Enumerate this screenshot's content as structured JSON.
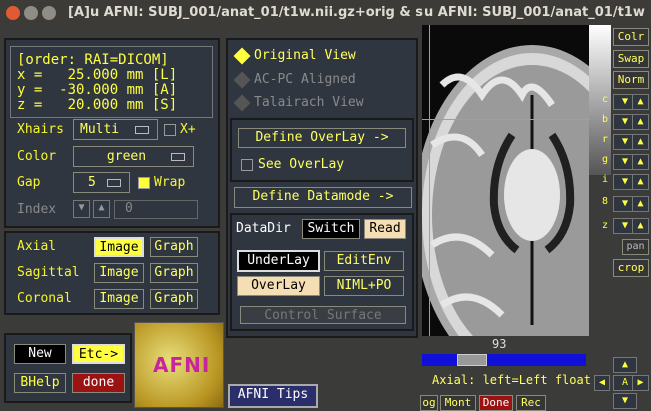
{
  "window": {
    "title": "[A]u AFNI: SUBJ_001/anat_01/t1w.nii.gz+orig & s",
    "title2": "u AFNI: SUBJ_001/anat_01/t1w"
  },
  "coords": {
    "order": "[order: RAI=DICOM]",
    "x": "x =   25.000 mm [L]",
    "y": "y =  -30.000 mm [A]",
    "z": "z =   20.000 mm [S]"
  },
  "xhairs": {
    "label": "Xhairs",
    "value": "Multi",
    "xplus": "X+"
  },
  "color": {
    "label": "Color",
    "value": "green"
  },
  "gap": {
    "label": "Gap",
    "value": "5",
    "wrap": "Wrap"
  },
  "index": {
    "label": "Index",
    "value": "0"
  },
  "views": [
    {
      "label": "Axial",
      "image": "Image",
      "graph": "Graph"
    },
    {
      "label": "Sagittal",
      "image": "Image",
      "graph": "Graph"
    },
    {
      "label": "Coronal",
      "image": "Image",
      "graph": "Graph"
    }
  ],
  "bottom": {
    "new": "New",
    "etc": "Etc->",
    "bhelp": "BHelp",
    "done": "done",
    "logo": "AFNI",
    "tips": "AFNI Tips"
  },
  "viewmode": {
    "original": "Original View",
    "acpc": "AC-PC Aligned",
    "talairach": "Talairach View"
  },
  "overlay": {
    "define": "Define OverLay ->",
    "see": "See OverLay",
    "datamode": "Define Datamode ->"
  },
  "data": {
    "datadir": "DataDir",
    "switch": "Switch",
    "read": "Read",
    "underlay": "UnderLay",
    "editenv": "EditEnv",
    "overlay": "OverLay",
    "niml": "NIML+PO",
    "control": "Control Surface"
  },
  "image": {
    "slice_num": "93",
    "status": "Axial: left=Left float",
    "buttons": [
      "Colr",
      "Swap",
      "Norm",
      "pan",
      "crop"
    ],
    "side": [
      "c",
      "b",
      "r",
      "g",
      "i",
      "8",
      "z"
    ],
    "bottom_btns": [
      "og",
      "Mont",
      "Done",
      "Rec"
    ],
    "arrow_a": "A"
  },
  "colors": {
    "accent": "#ffff40",
    "panel": "#2f3640"
  }
}
